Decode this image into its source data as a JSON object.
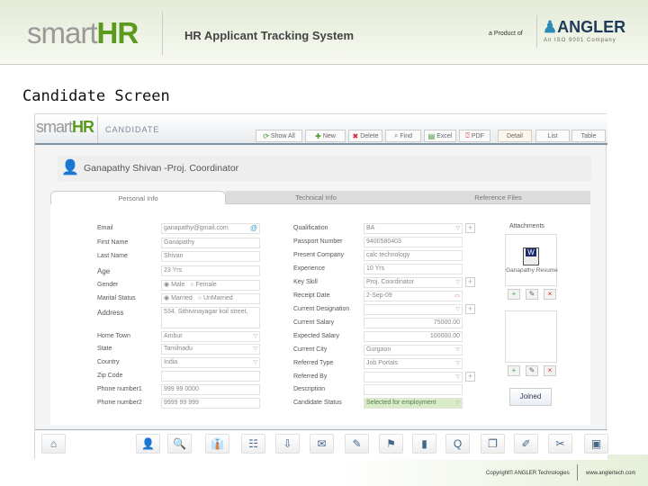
{
  "header": {
    "logo_light": "smart",
    "logo_bold": "HR",
    "title": "HR Applicant Tracking System",
    "product_of": "a Product of",
    "brand": "ANGLER",
    "brand_sub": "An ISO 9001 Company"
  },
  "page_title": "Candidate Screen",
  "app": {
    "logo_light": "smart",
    "logo_bold": "HR",
    "module": "CANDIDATE",
    "toolbar": [
      {
        "label": "Show All",
        "icon": "refresh-icon",
        "glyph": "⟳",
        "color": "#4a9a2a"
      },
      {
        "label": "New",
        "icon": "plus-icon",
        "glyph": "✚",
        "color": "#4a9a2a"
      },
      {
        "label": "Delete",
        "icon": "delete-icon",
        "glyph": "✖",
        "color": "#d23"
      },
      {
        "label": "Find",
        "icon": "search-icon",
        "glyph": "⌕",
        "color": "#678"
      },
      {
        "label": "Excel",
        "icon": "excel-icon",
        "glyph": "▤",
        "color": "#3a8a3a"
      },
      {
        "label": "PDF",
        "icon": "pdf-icon",
        "glyph": "⍰",
        "color": "#c44"
      }
    ],
    "views": [
      "Detail",
      "List",
      "Table"
    ],
    "candidate_name": "Ganapathy Shivan  -Proj. Coordinator",
    "tabs": [
      "Personal Info",
      "Technical Info",
      "Reference Files"
    ],
    "left_fields": [
      {
        "label": "Email",
        "value": "ganapathy@gmail.com",
        "type": "email"
      },
      {
        "label": "First Name",
        "value": "Ganapathy"
      },
      {
        "label": "Last Name",
        "value": "Shivan"
      },
      {
        "label": "Age",
        "value": "23 Yrs"
      },
      {
        "label": "Gender",
        "type": "radio",
        "options": [
          "Male",
          "Female"
        ]
      },
      {
        "label": "Marital Status",
        "type": "radio",
        "options": [
          "Married",
          "UnMarried"
        ]
      },
      {
        "label": "Address",
        "value": "534, Sithivinayagar koil street,",
        "type": "area"
      },
      {
        "label": "Home Town",
        "value": "Ambur",
        "type": "select"
      },
      {
        "label": "State",
        "value": "Tamilnadu",
        "type": "select"
      },
      {
        "label": "Country",
        "value": "India",
        "type": "select"
      },
      {
        "label": "Zip Code",
        "value": ""
      },
      {
        "label": "Phone number1",
        "value": "999 99 0000"
      },
      {
        "label": "Phone number2",
        "value": "9999 99 999"
      }
    ],
    "right_fields": [
      {
        "label": "Qualification",
        "value": "BA",
        "type": "select",
        "plus": true
      },
      {
        "label": "Passport Number",
        "value": "9400580403"
      },
      {
        "label": "Present Company",
        "value": "calc technology"
      },
      {
        "label": "Experience",
        "value": "10 Yrs"
      },
      {
        "label": "Key Skill",
        "value": "Proj. Coordinator",
        "type": "select",
        "plus": true
      },
      {
        "label": "Receipt Date",
        "value": "2-Sep-09",
        "type": "date"
      },
      {
        "label": "Current Designation",
        "value": "",
        "type": "select",
        "plus": true
      },
      {
        "label": "Current Salary",
        "value": "75000.00",
        "align": "right"
      },
      {
        "label": "Expected Salary",
        "value": "100000.00",
        "align": "right"
      },
      {
        "label": "Current City",
        "value": "Gurgaon",
        "type": "select"
      },
      {
        "label": "Referred Type",
        "value": "Job Portals",
        "type": "select"
      },
      {
        "label": "Referred By",
        "value": "",
        "type": "select",
        "plus": true
      },
      {
        "label": "Description",
        "value": ""
      },
      {
        "label": "Candidate Status",
        "value": "Selected for employment",
        "type": "select",
        "status": true
      }
    ],
    "attachments": {
      "title": "Attachments",
      "file": "Ganapathy Resume",
      "joined": "Joined"
    },
    "bottom_icons": [
      "home-icon",
      "candidate-icon",
      "search-icon",
      "employee-icon",
      "user-list-icon",
      "xml-export-icon",
      "mail-icon",
      "pen-icon",
      "chart-people-icon",
      "bar-chart-icon",
      "query-icon",
      "documents-icon",
      "notes-icon",
      "tools-icon",
      "database-icon"
    ]
  },
  "footer": {
    "copyright": "Copyright© ANGLER Technologies",
    "website": "www.anglertech.com"
  }
}
